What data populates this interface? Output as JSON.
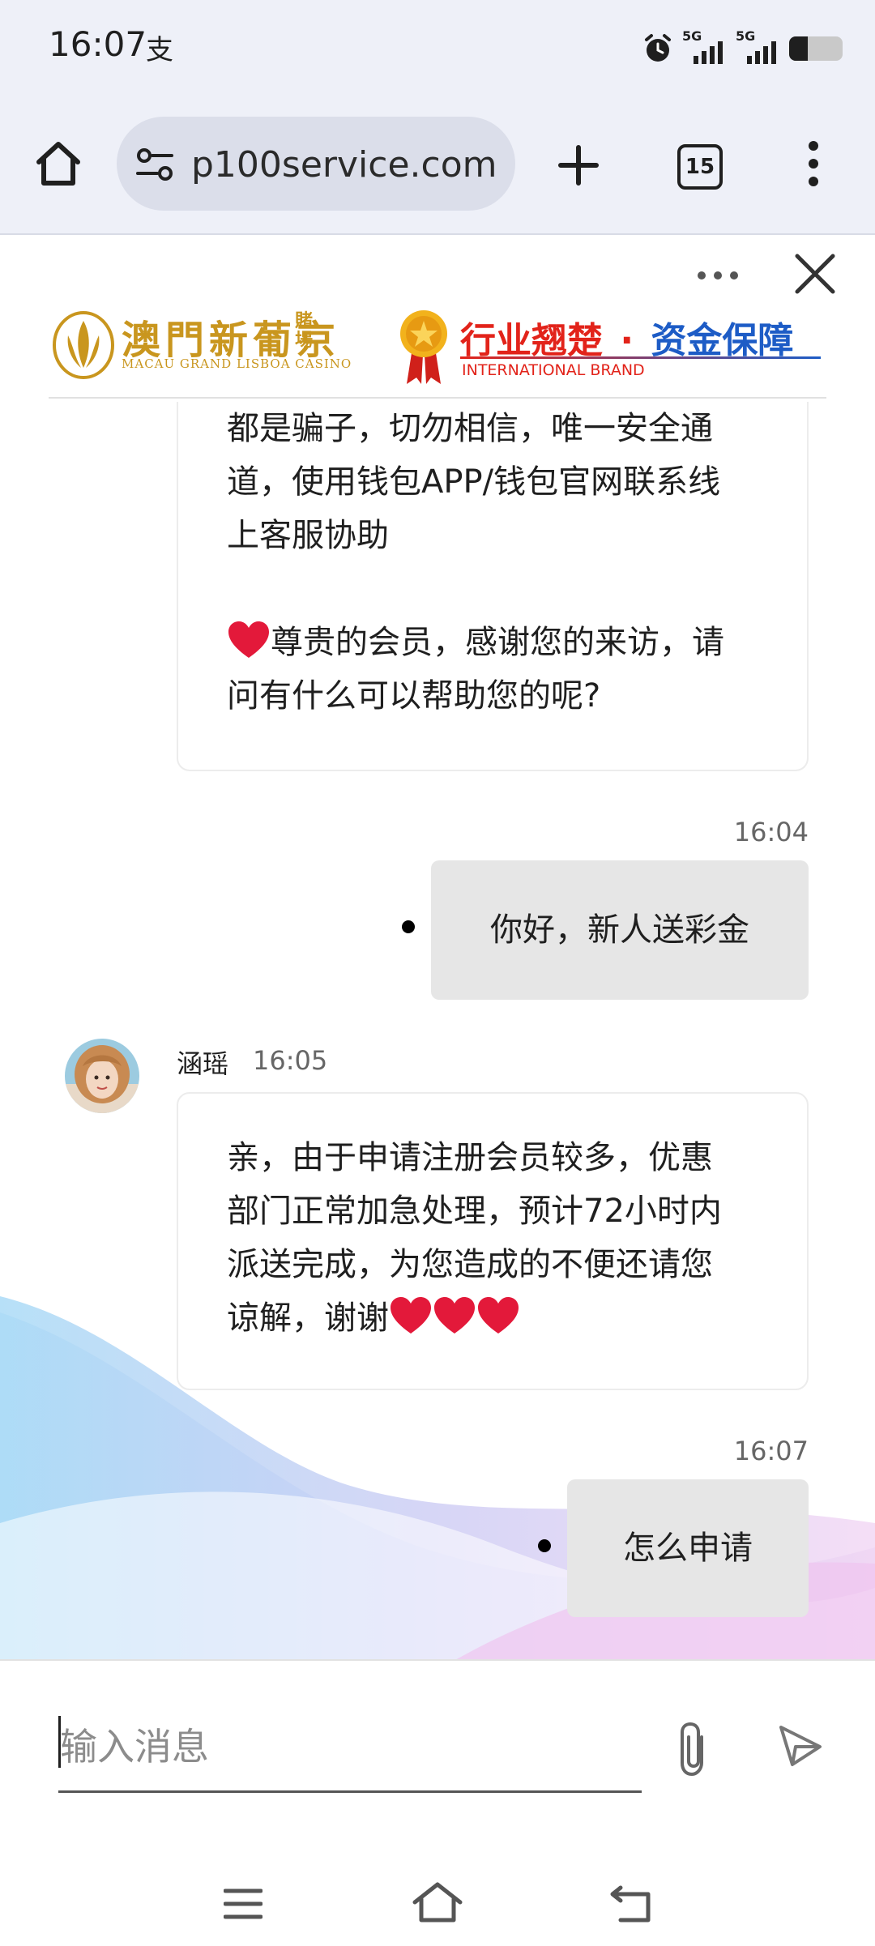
{
  "status_bar": {
    "time": "16:07",
    "alipay_icon": "alipay-icon",
    "network_1": "5G",
    "network_2": "5G",
    "battery_level": 0.35
  },
  "browser": {
    "url": "p100service.com",
    "tab_count": "15",
    "icons": [
      "home-icon",
      "site-settings-icon",
      "new-tab-icon",
      "tabs-icon",
      "overflow-menu-icon"
    ]
  },
  "chat_header": {
    "brand_left_cn": "澳門新葡京",
    "brand_left_cn_small": "賭場",
    "brand_left_en": "MACAU GRAND LISBOA CASINO",
    "brand_right_cn_1": "行业翘楚",
    "brand_right_sep": "·",
    "brand_right_cn_2": "资金保障",
    "brand_right_en": "INTERNATIONAL BRAND",
    "colors": {
      "gold": "#c9961e",
      "red": "#e2231a",
      "blue": "#1d5cc6"
    }
  },
  "messages": [
    {
      "direction": "in",
      "lines": [
        "都是骗子，切勿相信，唯一安全通",
        "道，使用钱包APP/钱包官网联系线",
        "上客服协助"
      ],
      "greeting_lines": [
        "尊贵的会员，感谢您的来访，请",
        "问有什么可以帮助您的呢?"
      ]
    },
    {
      "direction": "out",
      "time": "16:04",
      "text": "你好，新人送彩金"
    },
    {
      "direction": "in",
      "sender": "涵瑶",
      "time": "16:05",
      "lines": [
        "亲，由于申请注册会员较多，优惠",
        "部门正常加急处理，预计72小时内",
        "派送完成，为您造成的不便还请您",
        "谅解，谢谢"
      ]
    },
    {
      "direction": "out",
      "time": "16:07",
      "text": "怎么申请"
    }
  ],
  "input": {
    "placeholder": "输入消息",
    "icons": [
      "attachment-icon",
      "send-icon"
    ]
  },
  "nav_bar": {
    "icons": [
      "menu-icon",
      "home-icon",
      "back-icon"
    ]
  }
}
